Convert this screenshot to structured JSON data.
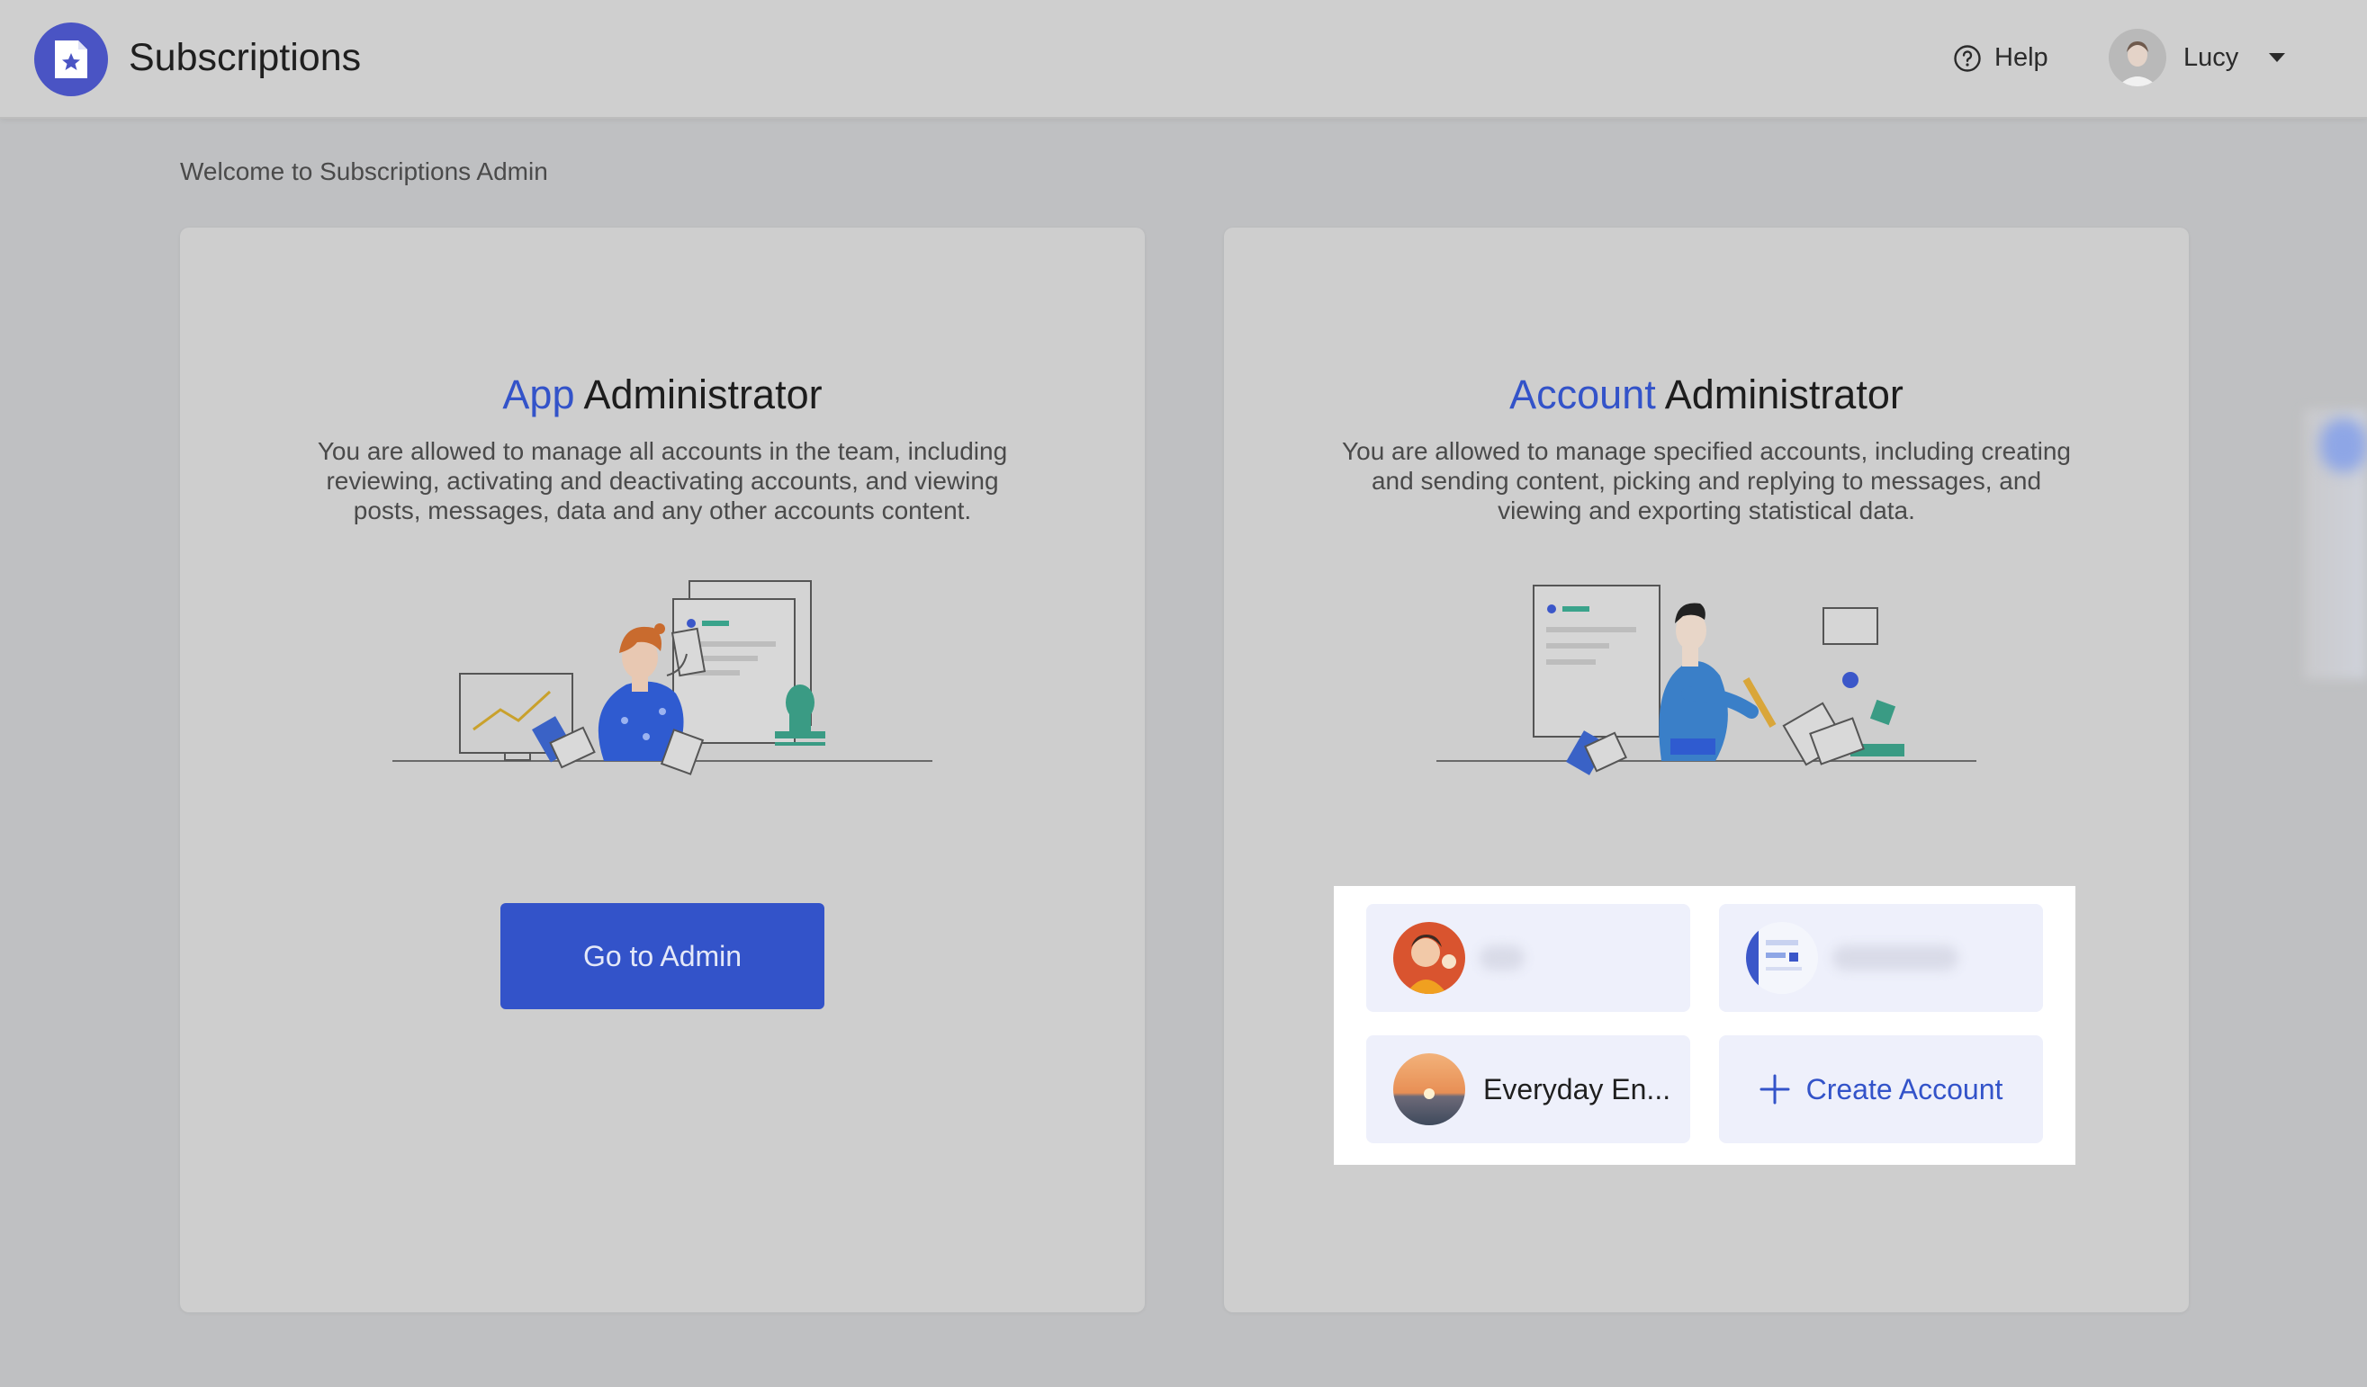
{
  "header": {
    "app_title": "Subscriptions",
    "help_label": "Help",
    "user_name": "Lucy"
  },
  "welcome_text": "Welcome to Subscriptions Admin",
  "app_card": {
    "title_accent": "App",
    "title_rest": " Administrator",
    "description": "You are allowed to manage all accounts in the team, including reviewing, activating and deactivating accounts, and viewing posts, messages, data and any other accounts content.",
    "button_label": "Go to Admin"
  },
  "account_card": {
    "title_accent": "Account",
    "title_rest": " Administrator",
    "description": "You are allowed to manage specified accounts, including creating and sending content, picking and replying to messages, and viewing and exporting statistical data.",
    "accounts": [
      {
        "name": ""
      },
      {
        "name": ""
      },
      {
        "name": "Everyday En..."
      }
    ],
    "create_label": "Create Account"
  },
  "colors": {
    "accent": "#3353c9",
    "logo": "#4a54c4"
  },
  "icons": [
    "star-document-icon",
    "help-circle-icon",
    "caret-down-icon",
    "plus-icon"
  ]
}
